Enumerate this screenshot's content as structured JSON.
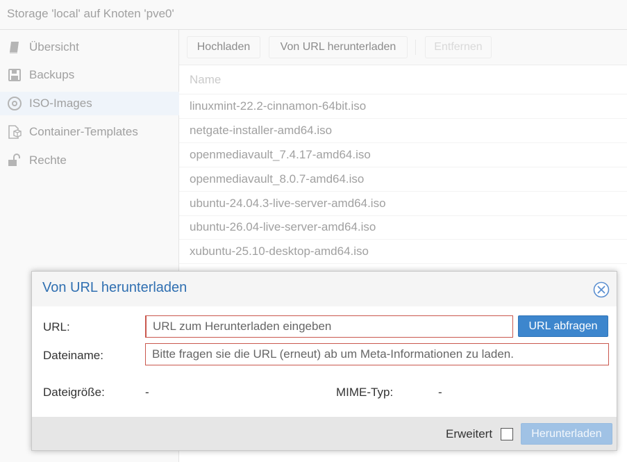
{
  "window": {
    "title": "Storage 'local' auf Knoten 'pve0'"
  },
  "sidebar": {
    "items": [
      {
        "label": "Übersicht",
        "icon": "book-icon",
        "active": false
      },
      {
        "label": "Backups",
        "icon": "floppy-disk-icon",
        "active": false
      },
      {
        "label": "ISO-Images",
        "icon": "disc-icon",
        "active": true
      },
      {
        "label": "Container-Templates",
        "icon": "file-cube-icon",
        "active": false
      },
      {
        "label": "Rechte",
        "icon": "unlock-icon",
        "active": false
      }
    ]
  },
  "toolbar": {
    "upload_label": "Hochladen",
    "download_url_label": "Von URL herunterladen",
    "remove_label": "Entfernen"
  },
  "grid": {
    "column_name": "Name",
    "rows": [
      "linuxmint-22.2-cinnamon-64bit.iso",
      "netgate-installer-amd64.iso",
      "openmediavault_7.4.17-amd64.iso",
      "openmediavault_8.0.7-amd64.iso",
      "ubuntu-24.04.3-live-server-amd64.iso",
      "ubuntu-26.04-live-server-amd64.iso",
      "xubuntu-25.10-desktop-amd64.iso"
    ]
  },
  "dialog": {
    "title": "Von URL herunterladen",
    "url_label": "URL:",
    "url_value": "",
    "url_placeholder": "URL zum Herunterladen eingeben",
    "query_button": "URL abfragen",
    "filename_label": "Dateiname:",
    "filename_value": "",
    "filename_placeholder": "Bitte fragen sie die URL (erneut) ab um Meta-Informationen zu laden.",
    "filesize_label": "Dateigröße:",
    "filesize_value": "-",
    "mimetype_label": "MIME-Typ:",
    "mimetype_value": "-",
    "advanced_label": "Erweitert",
    "advanced_checked": false,
    "download_button": "Herunterladen"
  },
  "colors": {
    "accent": "#3d86cd",
    "title_blue": "#2f6fb1",
    "invalid_border": "#c9574d",
    "active_nav": "#e6eef7"
  }
}
